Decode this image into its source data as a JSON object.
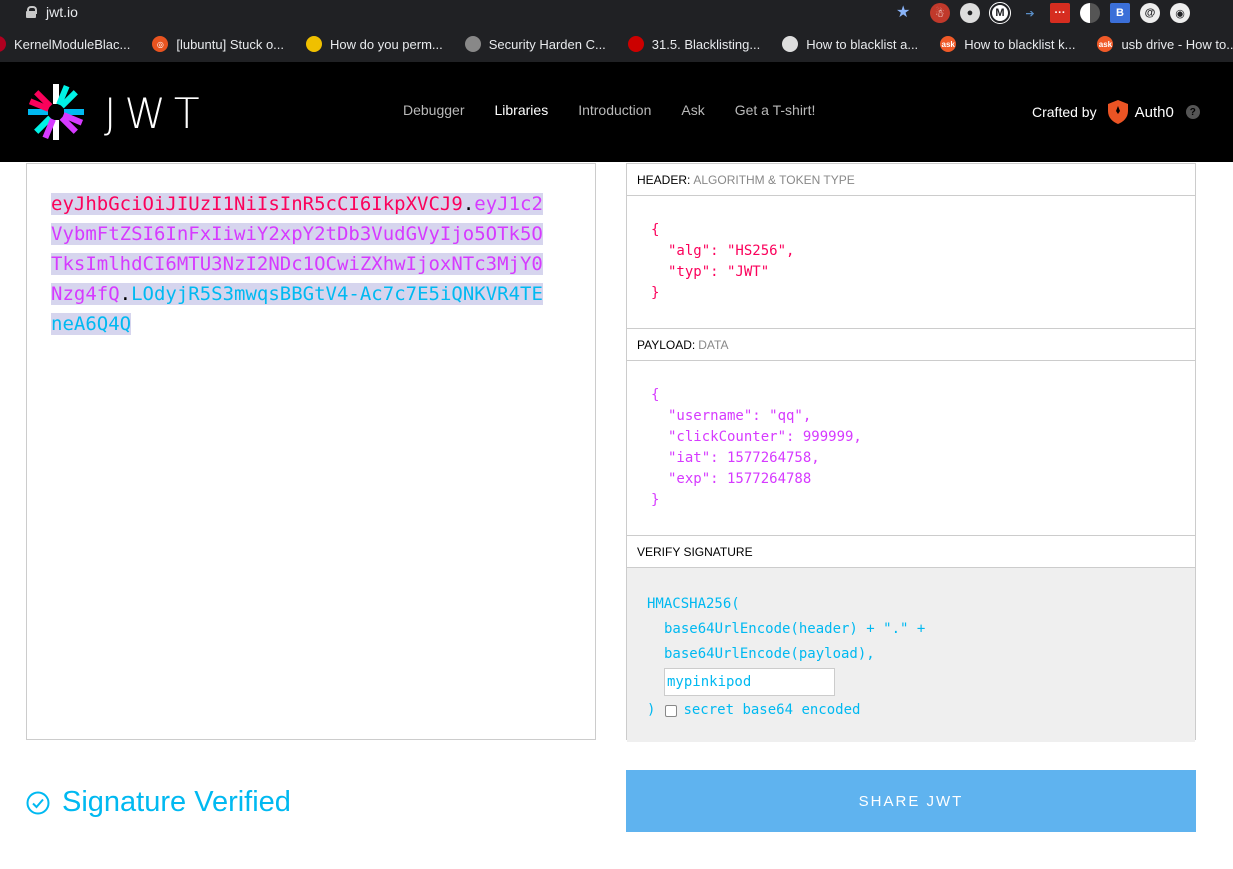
{
  "browser": {
    "url": "jwt.io",
    "extensions": [
      "santa-icon",
      "record-icon",
      "m-icon",
      "arrow-icon",
      "dots-icon",
      "contrast-icon",
      "b-icon",
      "at-icon",
      "circle-icon"
    ]
  },
  "bookmarks": [
    {
      "label": "KernelModuleBlac...",
      "color": "#b00020"
    },
    {
      "label": "[lubuntu] Stuck o...",
      "color": "#e95420"
    },
    {
      "label": "How do you perm...",
      "color": "#f0c000"
    },
    {
      "label": "Security Harden C...",
      "color": "#888888"
    },
    {
      "label": "31.5. Blacklisting...",
      "color": "#cc0000"
    },
    {
      "label": "How to blacklist a...",
      "color": "#dddddd"
    },
    {
      "label": "How to blacklist k...",
      "color": "#f05a28"
    },
    {
      "label": "usb drive - How to...",
      "color": "#f05a28"
    }
  ],
  "nav": {
    "brand": "JWT",
    "links": [
      "Debugger",
      "Libraries",
      "Introduction",
      "Ask",
      "Get a T-shirt!"
    ],
    "active": "Libraries",
    "crafted_by": "Crafted by",
    "partner": "Auth0",
    "help": "?"
  },
  "encoded": {
    "header": "eyJhbGciOiJIUzI1NiIsInR5cCI6IkpXVCJ9",
    "payload": "eyJ1c2VybmFtZSI6InFxIiwiY2xpY2tDb3VudGVyIjo5OTk5OTksImlhdCI6MTU3NzI2NDc1OCwiZXhwIjoxNTc3MjY0Nzg4fQ",
    "signature": "LOdyjR5S3mwqsBBGtV4-Ac7c7E5iQNKVR4TEneA6Q4Q",
    "dot": "."
  },
  "decoded": {
    "header_title": "HEADER:",
    "header_sub": "ALGORITHM & TOKEN TYPE",
    "header_lines": [
      "{",
      "\"alg\": \"HS256\",",
      "\"typ\": \"JWT\"",
      "}"
    ],
    "payload_title": "PAYLOAD:",
    "payload_sub": "DATA",
    "payload_lines": [
      "{",
      "\"username\": \"qq\",",
      "\"clickCounter\": 999999,",
      "\"iat\": 1577264758,",
      "\"exp\": 1577264788",
      "}"
    ],
    "verify_title": "VERIFY SIGNATURE",
    "verify_lines": [
      "HMACSHA256(",
      "base64UrlEncode(header) + \".\" +",
      "base64UrlEncode(payload),"
    ],
    "secret": "mypinkipod",
    "close_paren": ")",
    "b64_label": "secret base64 encoded"
  },
  "footer": {
    "status": "Signature Verified",
    "share": "SHARE JWT"
  },
  "colors": {
    "header": "#fb015b",
    "payload": "#d63aff",
    "signature": "#00b9f1",
    "share_bg": "#5fb3ef"
  }
}
